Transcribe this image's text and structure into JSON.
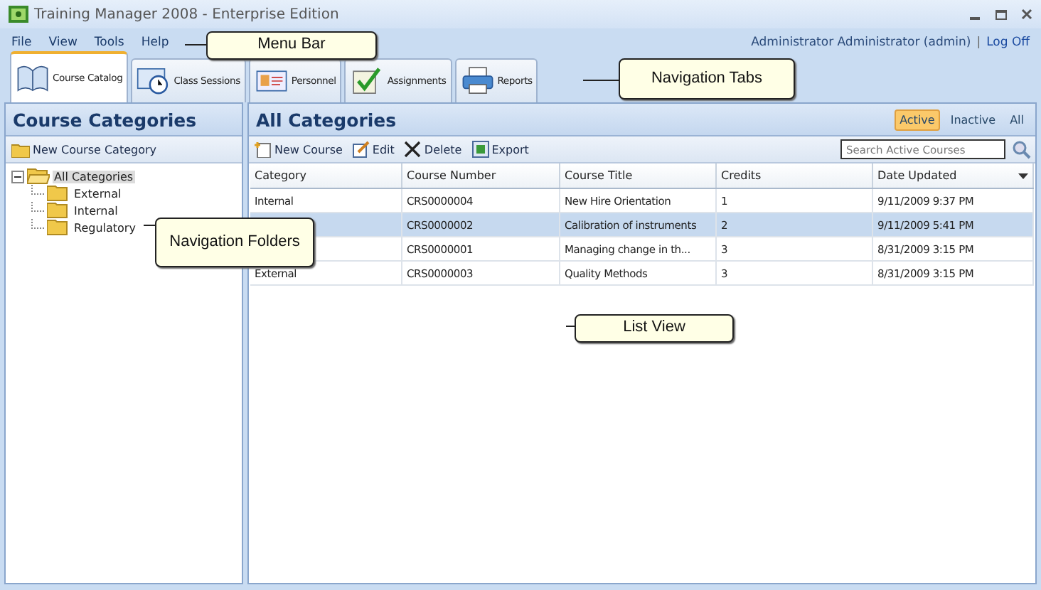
{
  "window": {
    "title": "Training Manager 2008 - Enterprise Edition"
  },
  "menu": [
    "File",
    "View",
    "Tools",
    "Help"
  ],
  "user": {
    "name": "Administrator Administrator (admin)",
    "separator": "|",
    "logoff": "Log Off"
  },
  "tabs": [
    {
      "label": "Course Catalog",
      "selected": true
    },
    {
      "label": "Class Sessions",
      "selected": false
    },
    {
      "label": "Personnel",
      "selected": false
    },
    {
      "label": "Assignments",
      "selected": false
    },
    {
      "label": "Reports",
      "selected": false
    }
  ],
  "sidebar": {
    "title": "Course Categories",
    "new_button": "New Course Category",
    "tree": [
      {
        "label": "All Categories",
        "expanded": true,
        "selected": true,
        "children": [
          {
            "label": "External"
          },
          {
            "label": "Internal"
          },
          {
            "label": "Regulatory"
          }
        ]
      }
    ]
  },
  "main": {
    "title": "All Categories",
    "filters": [
      {
        "label": "Active",
        "selected": true
      },
      {
        "label": "Inactive",
        "selected": false
      },
      {
        "label": "All",
        "selected": false
      }
    ],
    "toolbar": [
      "New Course",
      "Edit",
      "Delete",
      "Export"
    ],
    "search": {
      "placeholder": "Search Active Courses"
    },
    "table": {
      "columns": [
        "Category",
        "Course Number",
        "Course Title",
        "Credits",
        "Date Updated"
      ],
      "rows": [
        {
          "cells": [
            "Internal",
            "CRS0000004",
            "New Hire Orientation",
            "1",
            "9/11/2009 9:37 PM"
          ],
          "selected": false
        },
        {
          "cells": [
            null,
            "CRS0000002",
            "Calibration of instruments",
            "2",
            "9/11/2009 5:41 PM"
          ],
          "selected": true
        },
        {
          "cells": [
            null,
            "CRS0000001",
            "Managing change in th...",
            "3",
            "8/31/2009 3:15 PM"
          ],
          "selected": false
        },
        {
          "cells": [
            "External",
            "CRS0000003",
            "Quality Methods",
            "3",
            "8/31/2009 3:15 PM"
          ],
          "selected": false
        }
      ]
    }
  },
  "callouts": [
    "Menu Bar",
    "Navigation Tabs",
    "Navigation Folders",
    "List View"
  ]
}
